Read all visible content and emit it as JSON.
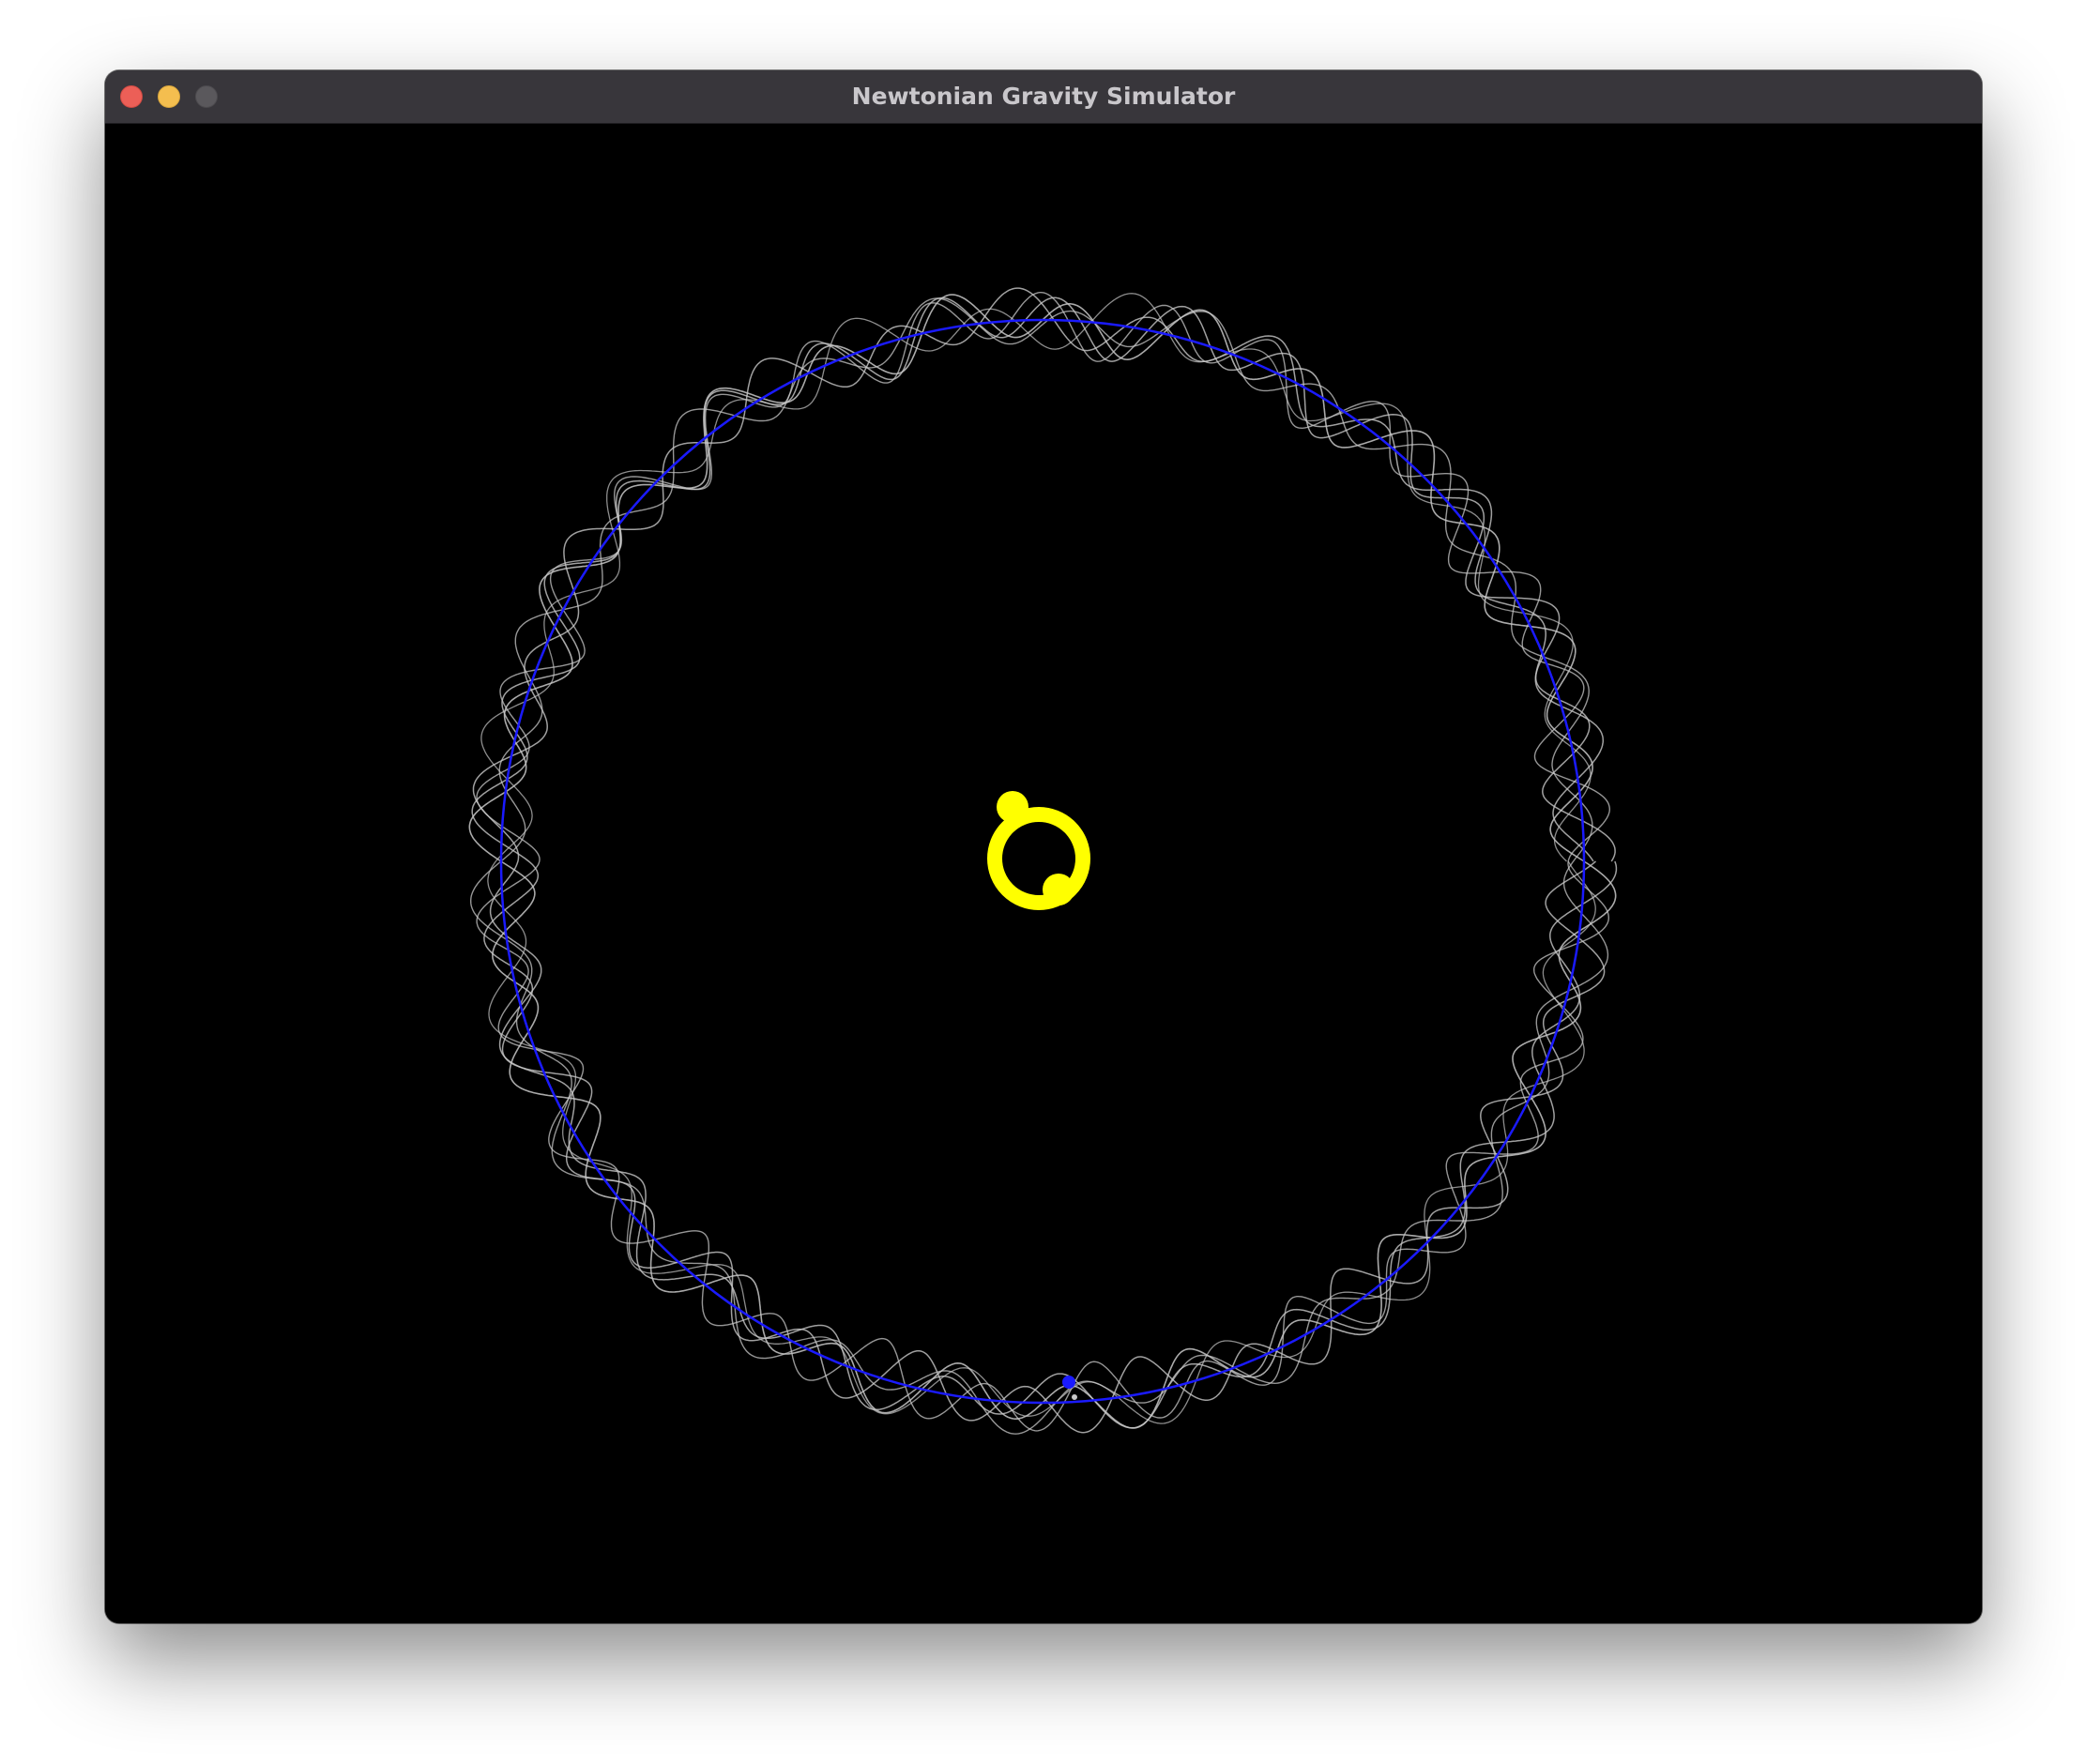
{
  "window": {
    "title": "Newtonian Gravity Simulator"
  },
  "simulation": {
    "background_color": "#000000",
    "central_body": {
      "color": "#ffff00",
      "trail_color": "#ffff00",
      "description_icon": "sun-icon"
    },
    "planet": {
      "color": "#1a1aff",
      "orbit_color": "#1a1aff"
    },
    "moon": {
      "trail_color": "#c8c8c8",
      "loops_per_orbit": 28
    }
  }
}
